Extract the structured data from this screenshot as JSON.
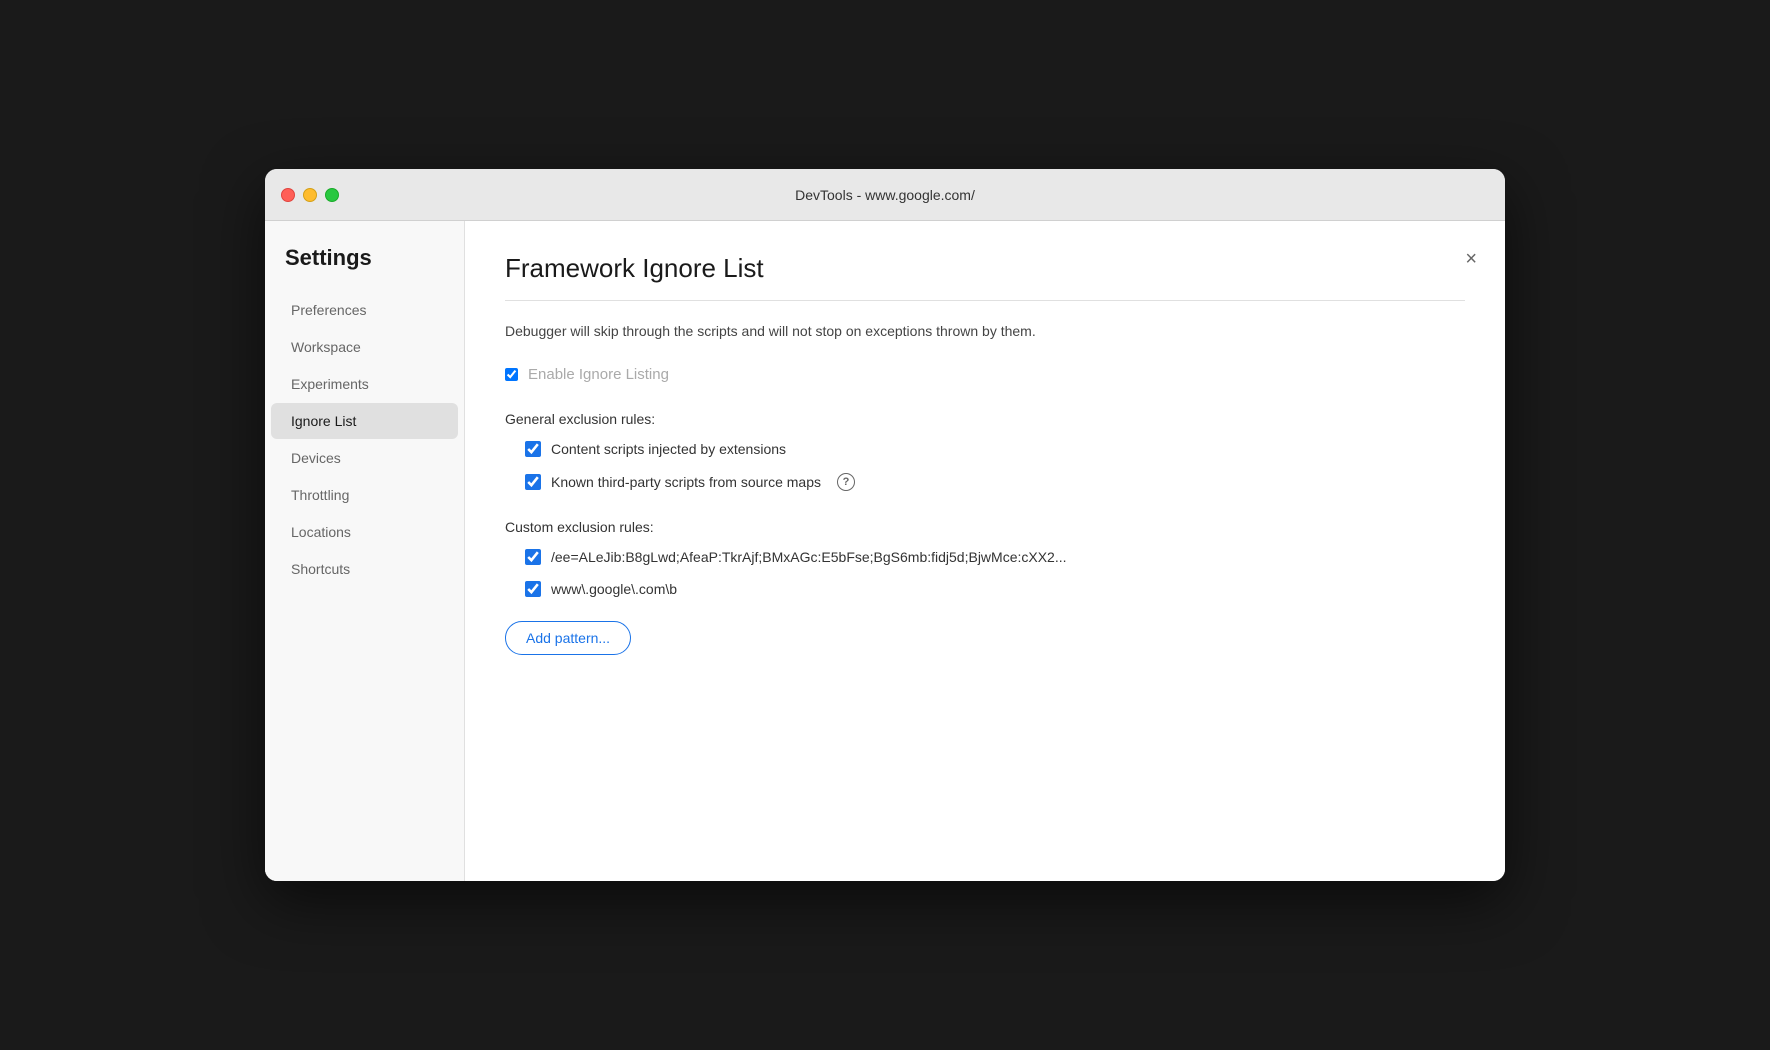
{
  "window": {
    "title": "DevTools - www.google.com/"
  },
  "sidebar": {
    "heading": "Settings",
    "items": [
      {
        "id": "preferences",
        "label": "Preferences",
        "active": false
      },
      {
        "id": "workspace",
        "label": "Workspace",
        "active": false
      },
      {
        "id": "experiments",
        "label": "Experiments",
        "active": false
      },
      {
        "id": "ignore-list",
        "label": "Ignore List",
        "active": true
      },
      {
        "id": "devices",
        "label": "Devices",
        "active": false
      },
      {
        "id": "throttling",
        "label": "Throttling",
        "active": false
      },
      {
        "id": "locations",
        "label": "Locations",
        "active": false
      },
      {
        "id": "shortcuts",
        "label": "Shortcuts",
        "active": false
      }
    ]
  },
  "main": {
    "title": "Framework Ignore List",
    "description": "Debugger will skip through the scripts and will not stop on exceptions thrown by them.",
    "close_btn": "×",
    "enable_ignore_listing": {
      "label": "Enable Ignore Listing",
      "checked": true
    },
    "general_exclusion_label": "General exclusion rules:",
    "general_rules": [
      {
        "id": "content-scripts",
        "label": "Content scripts injected by extensions",
        "checked": true,
        "has_info": false
      },
      {
        "id": "third-party-scripts",
        "label": "Known third-party scripts from source maps",
        "checked": true,
        "has_info": true
      }
    ],
    "custom_exclusion_label": "Custom exclusion rules:",
    "custom_rules": [
      {
        "id": "custom-rule-1",
        "label": "/ee=ALeJib:B8gLwd;AfeaP:TkrAjf;BMxAGc:E5bFse;BgS6mb:fidj5d;BjwMce:cXX2...",
        "checked": true
      },
      {
        "id": "custom-rule-2",
        "label": "www\\.google\\.com\\b",
        "checked": true
      }
    ],
    "add_pattern_label": "Add pattern..."
  }
}
